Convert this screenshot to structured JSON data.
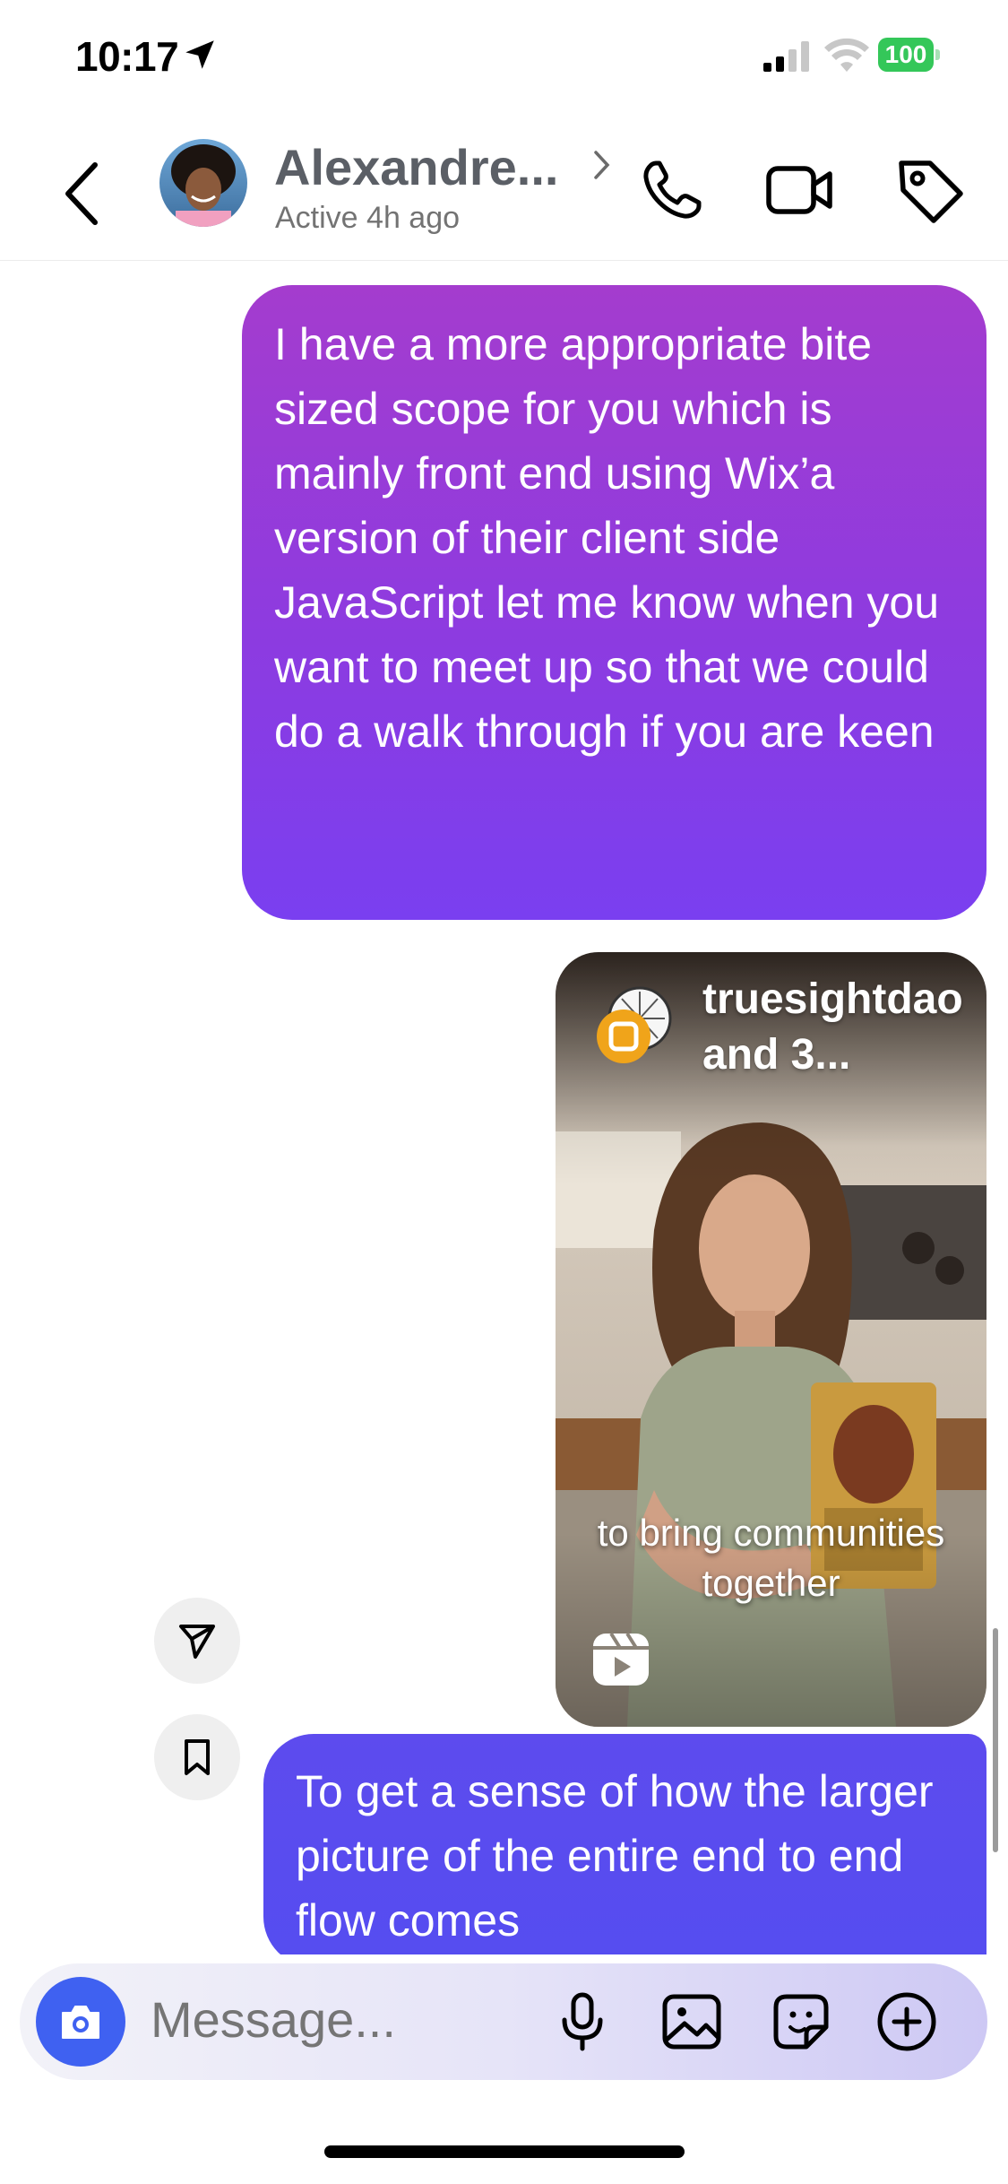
{
  "status_bar": {
    "time": "10:17",
    "battery": "100",
    "battery_color": "#34c759"
  },
  "header": {
    "contact_name": "Alexandre...",
    "status": "Active 4h ago",
    "icons": [
      "back-chevron-icon",
      "phone-icon",
      "video-call-icon",
      "tag-icon"
    ]
  },
  "messages": [
    {
      "type": "text",
      "sender": "me",
      "text": "I have a more appropriate bite sized scope for you which is mainly front end using Wix’a version of their client side JavaScript let me know when you want to meet up so that we could do a walk through if you are keen"
    },
    {
      "type": "reel",
      "sender": "me",
      "author": "truesightdao and 3...",
      "caption": "to bring communities together",
      "icon": "reels-icon"
    },
    {
      "type": "text",
      "sender": "me",
      "text": "To get a sense of how the larger picture of the entire end to end flow comes"
    }
  ],
  "reel_actions": [
    "share-icon",
    "save-bookmark-icon"
  ],
  "composer": {
    "placeholder": "Message...",
    "icons": [
      "camera-icon",
      "microphone-icon",
      "gallery-icon",
      "sticker-icon",
      "plus-icon"
    ]
  },
  "colors": {
    "bubble_purple_top": "#a43cce",
    "bubble_purple_bottom": "#7a3ff0",
    "bubble_blue": "#554df0",
    "camera_button": "#3f61f1"
  }
}
